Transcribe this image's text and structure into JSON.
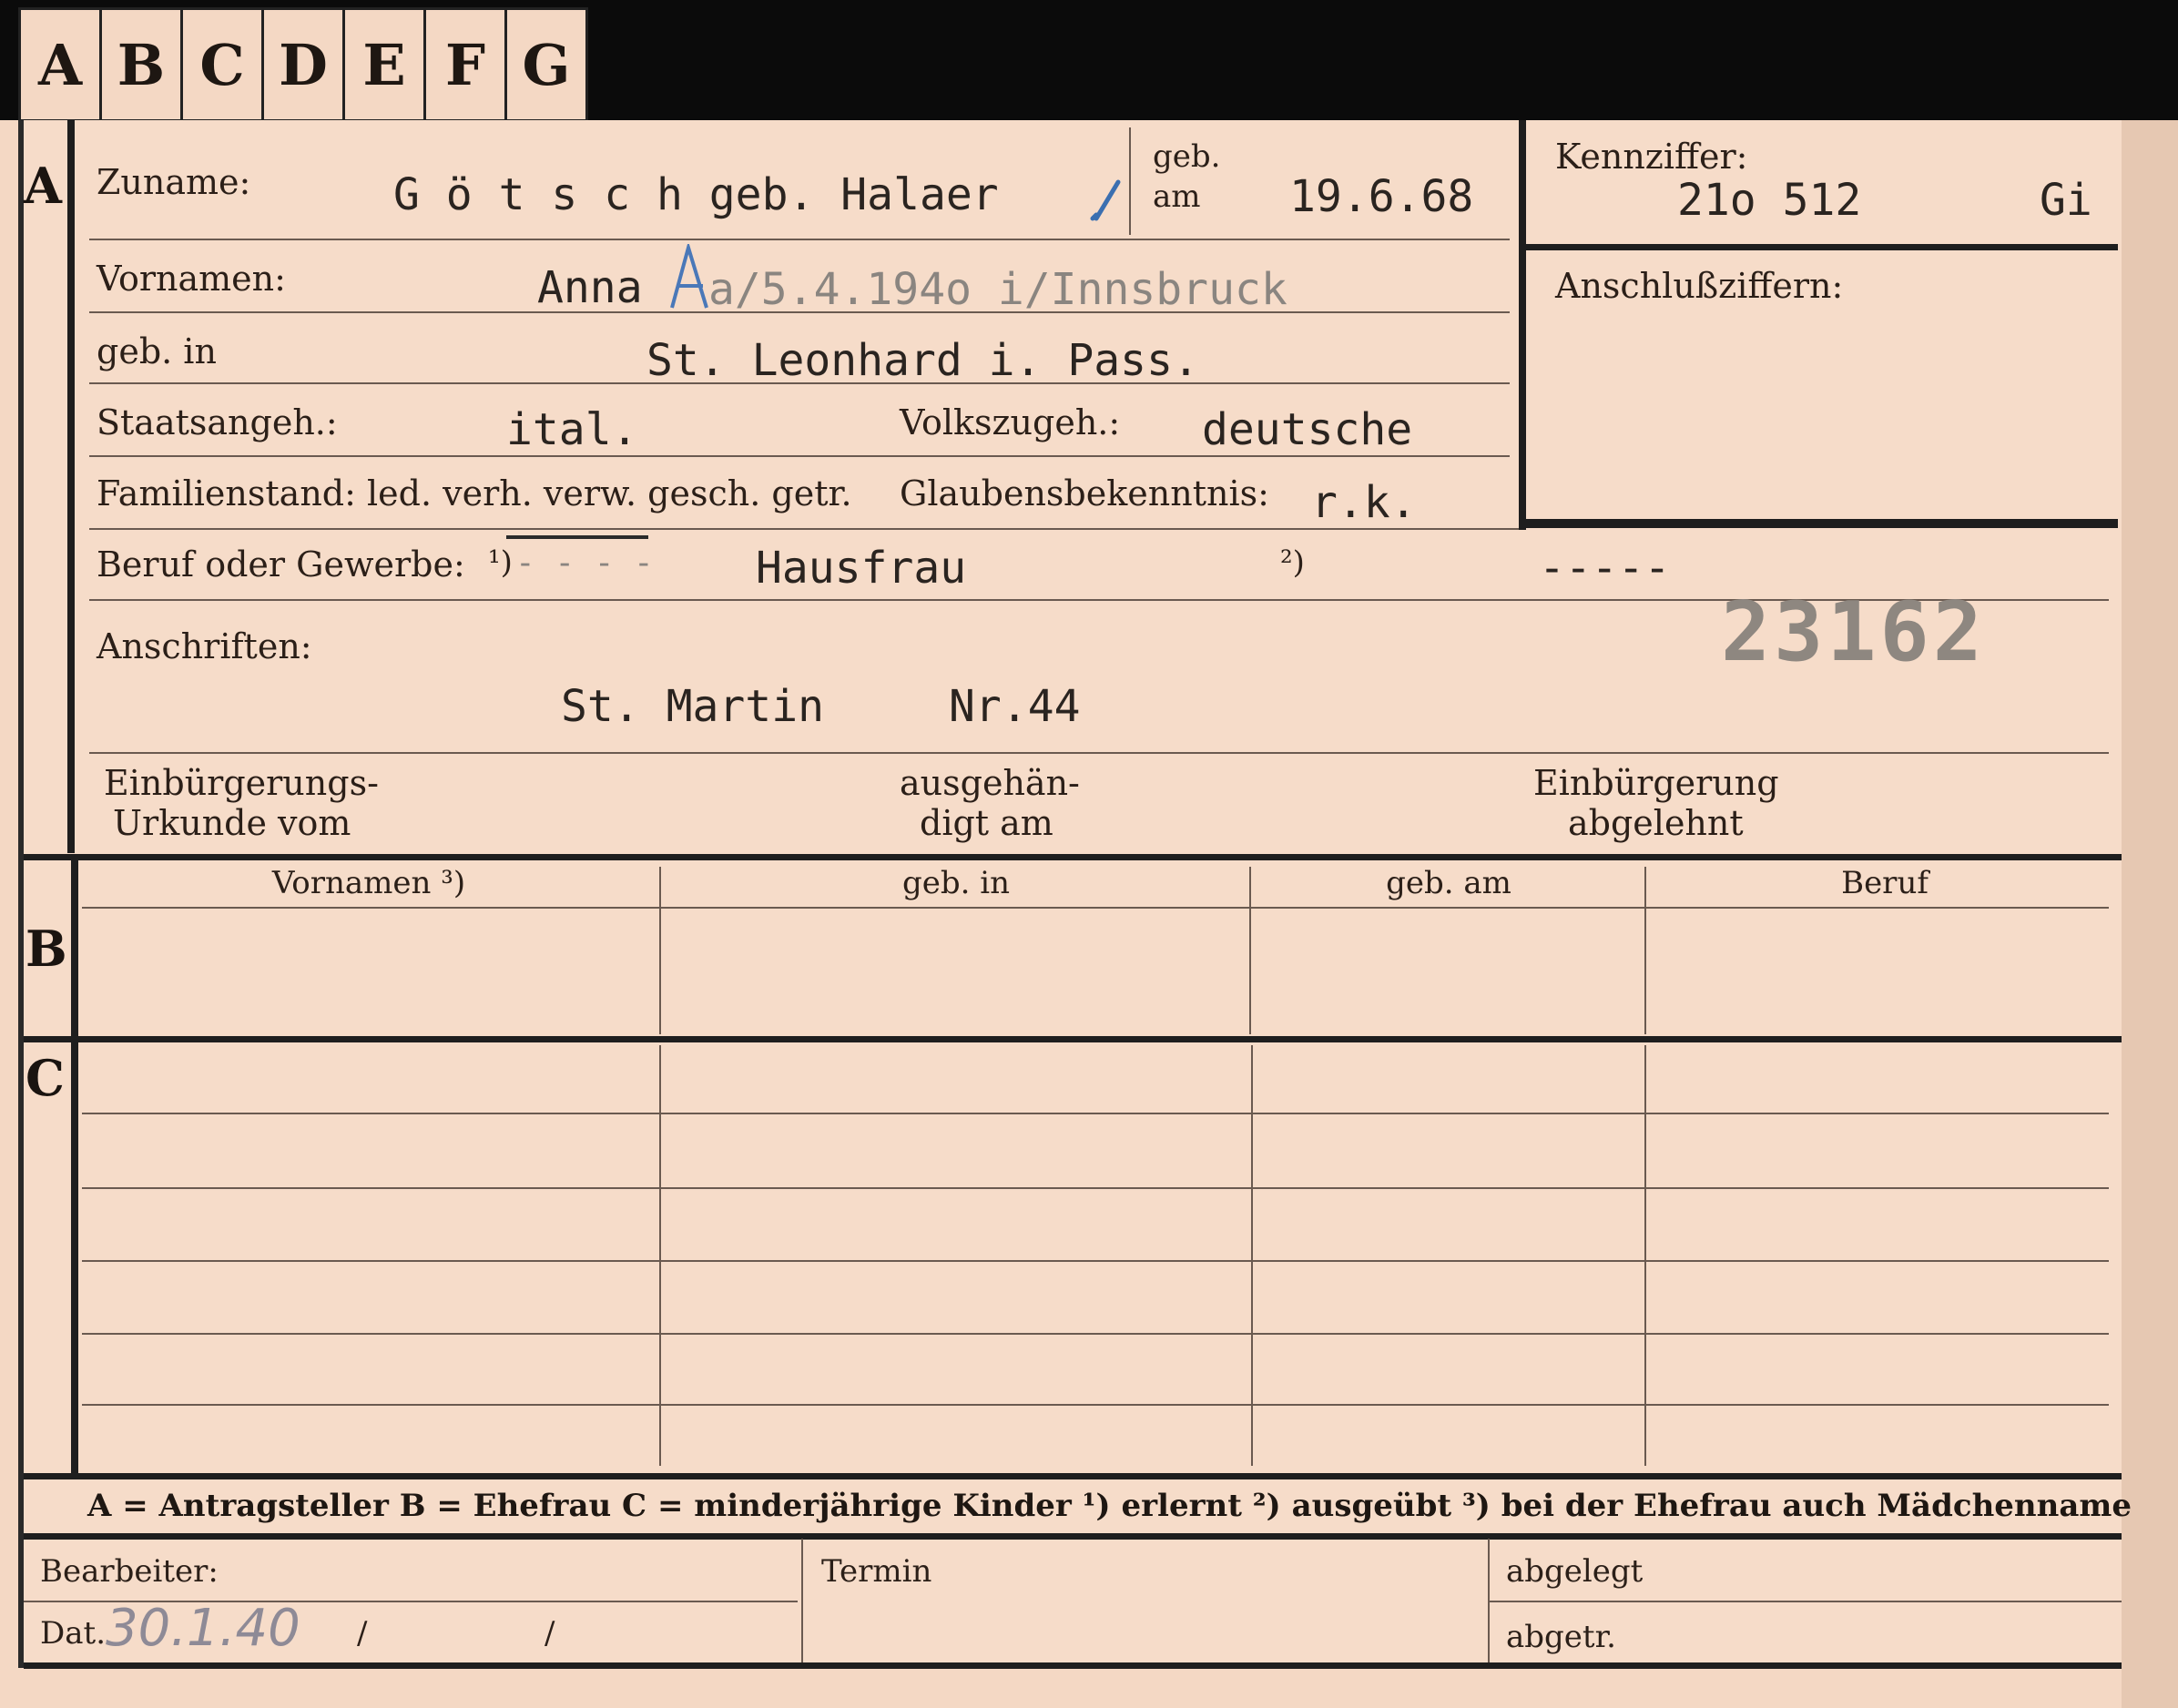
{
  "tabs": [
    "A",
    "B",
    "C",
    "D",
    "E",
    "F",
    "G"
  ],
  "sections": {
    "a": "A",
    "b": "B",
    "c": "C"
  },
  "labels": {
    "zuname": "Zuname:",
    "geb_am_1": "geb.",
    "geb_am_2": "am",
    "vornamen": "Vornamen:",
    "geb_in": "geb. in",
    "staatsangeh": "Staatsangeh.:",
    "volkszugeh": "Volkszugeh.:",
    "familienstand": "Familienstand: led. verh. verw. gesch. getr.",
    "glaubens": "Glaubensbekenntnis:",
    "beruf": "Beruf oder Gewerbe:",
    "beruf_mark1": "¹)",
    "beruf_mark2": "²)",
    "anschriften": "Anschriften:",
    "einb_1": "Einbürgerungs-",
    "einb_2": "Urkunde vom",
    "ausgeh_1": "ausgehän-",
    "ausgeh_2": "digt am",
    "abgel_1": "Einbürgerung",
    "abgel_2": "abgelehnt",
    "kennziffer": "Kennziffer:",
    "anschluss": "Anschlußziffern:"
  },
  "values": {
    "zuname": "G ö t s c h  geb. Halaer",
    "geb_am": "19.6.68",
    "vornamen_a": "Anna",
    "vornamen_b": "a/5.4.194o i/Innsbruck",
    "geb_in": "St. Leonhard i. Pass.",
    "staatsangeh": "ital.",
    "volkszugeh": "deutsche",
    "glaubens": "r.k.",
    "beruf_dash1": "- - - -",
    "beruf": "Hausfrau",
    "beruf_dash2": "-----",
    "anschrift_ort": "St. Martin",
    "anschrift_nr": "Nr.44",
    "kennziffer": "21o 512",
    "kennziffer_suffix": "Gi",
    "stamp_number": "23162"
  },
  "table_headers": [
    "Vornamen ³)",
    "geb. in",
    "geb. am",
    "Beruf"
  ],
  "footer": {
    "legend": "A = Antragsteller   B = Ehefrau   C = minderjährige Kinder   ¹) erlernt   ²) ausgeübt   ³) bei der Ehefrau auch Mädchenname",
    "bearbeiter": "Bearbeiter:",
    "dat": "Dat.",
    "dat_value": "30.1.40",
    "slash1": "/",
    "slash2": "/",
    "termin": "Termin",
    "abgelegt": "abgelegt",
    "abgetr": "abgetr."
  }
}
